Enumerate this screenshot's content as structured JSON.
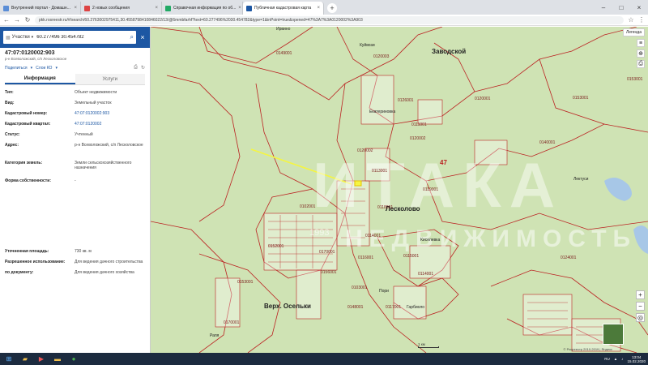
{
  "browser": {
    "tabs": [
      {
        "title": "Внутренний портал - Домашн...",
        "active": false
      },
      {
        "title": "2 новых сообщения",
        "active": false
      },
      {
        "title": "Справочная информация по об...",
        "active": false
      },
      {
        "title": "Публичная кадастровая карта",
        "active": true
      }
    ],
    "url": "pkk.rosreestr.ru/#/search/60.2763002975411,30.4558798410846022/13/@6mmbfarhf?text=60.277496%2030.454782&type=1&inPoint=true&opened=47%3A7%3A0120002%3A903"
  },
  "search": {
    "type_label": "Участки",
    "query": "60.277496 30.454782"
  },
  "object": {
    "cadastral_number": "47:07:0120002:903",
    "subtitle": "р-н Всеволожский, с/п Лесколовское",
    "tools": {
      "print": "Поделиться",
      "share": "Слои КО"
    }
  },
  "tabs": {
    "info": "Информация",
    "services": "Услуги"
  },
  "attributes": [
    {
      "key": "Тип:",
      "value": "Объект недвижимости",
      "link": false
    },
    {
      "key": "Вид:",
      "value": "Земельный участок",
      "link": false
    },
    {
      "key": "Кадастровый номер:",
      "value": "47:07:0120002:903",
      "link": true
    },
    {
      "key": "Кадастровый квартал:",
      "value": "47:07:0120002",
      "link": true
    },
    {
      "key": "Статус:",
      "value": "Учтенный",
      "link": false
    },
    {
      "key": "Адрес:",
      "value": "р-н Всеволожский, с/п Лесколовское",
      "link": false
    },
    {
      "key": "Категория земель:",
      "value": "Земли сельскохозяйственного назначения",
      "link": false
    },
    {
      "key": "Форма собственности:",
      "value": "-",
      "link": false
    }
  ],
  "attributes2": [
    {
      "key": "Уточненная площадь:",
      "value": "730 кв. м"
    },
    {
      "key": "Разрешенное использование:",
      "value": "Для ведения дачного строительства"
    },
    {
      "key": "по документу:",
      "value": "Для ведения дачного хозяйства"
    }
  ],
  "map": {
    "layers_button": "Легенда",
    "places": {
      "zavodskoy": "Заводской",
      "leskolovo": "Лесколово",
      "verkh_oselki": "Верх. Осельки",
      "ekaterinovka": "Екатериновка",
      "kiselevka": "Киселевка",
      "pori": "Пори",
      "lektuzi": "Лектуси",
      "kuivozi": "Куйвози",
      "irvino": "Ирвино",
      "raya": "Рапя",
      "lemboloro": "Гарбиоло"
    },
    "quarters": [
      "0120003",
      "0153001",
      "0153001",
      "0149001",
      "0120001",
      "0120002",
      "0120002",
      "0126001",
      "0102001",
      "0111001",
      "0114001",
      "0113001",
      "0103001",
      "0118001",
      "0114001",
      "0115001",
      "0116001",
      "0170001",
      "0148001",
      "0119001",
      "0124001",
      "0153001",
      "0152001",
      "0156001",
      "0170001",
      "0117001",
      "0140001"
    ],
    "region_number": "47",
    "scale_label": "1 км",
    "attribution": "© Росреестр 2010-2019 | Яндекс",
    "watermark": "ИТАКА",
    "watermark_sub": "НЕДВИЖИМОСТЬ",
    "watermark_year": "1993"
  },
  "taskbar": {
    "lang": "RU",
    "time": "13:04",
    "date": "15.02.2020"
  }
}
